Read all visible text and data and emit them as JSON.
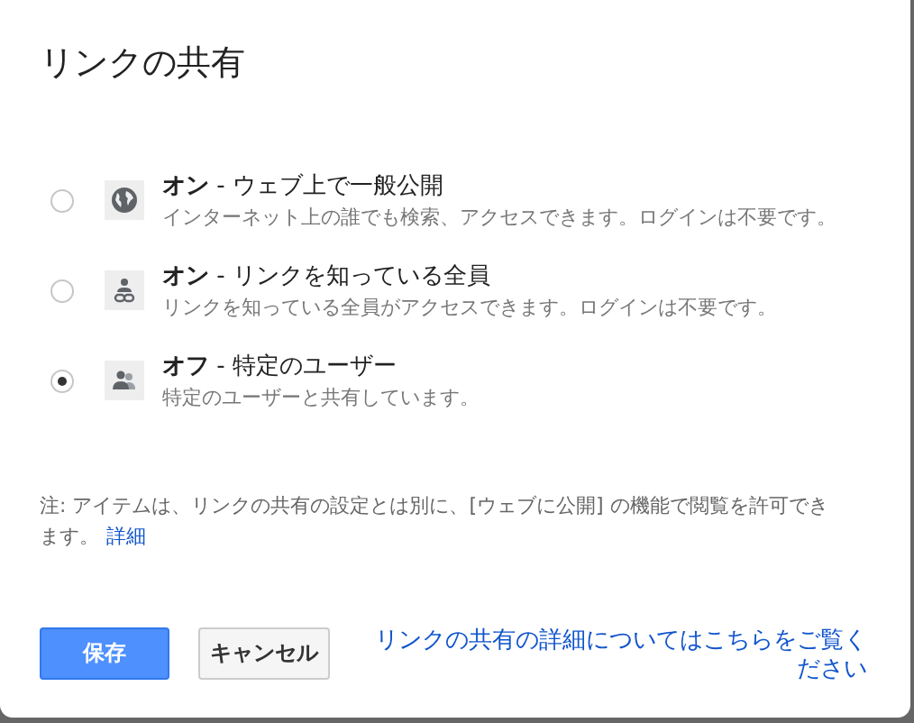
{
  "dialog": {
    "title": "リンクの共有"
  },
  "options": [
    {
      "kind": "globe",
      "title": "**オン** - ウェブ上で一般公開",
      "description": "インターネット上の誰でも検索、アクセスできます。ログインは不要です。",
      "selected": false
    },
    {
      "kind": "link",
      "title": "**オン** - リンクを知っている全員",
      "description": "リンクを知っている全員がアクセスできます。ログインは不要です。",
      "selected": false
    },
    {
      "kind": "people",
      "title": "**オフ** - 特定のユーザー",
      "description": "特定のユーザーと共有しています。",
      "selected": true
    }
  ],
  "note": {
    "text": "注: アイテムは、リンクの共有の設定とは別に、[ウェブに公開] の機能で閲覧を許可できます。",
    "link": "詳細"
  },
  "buttons": {
    "save": "保存",
    "cancel": "キャンセル"
  },
  "help_link": "リンクの共有の詳細についてはこちらをご覧ください"
}
